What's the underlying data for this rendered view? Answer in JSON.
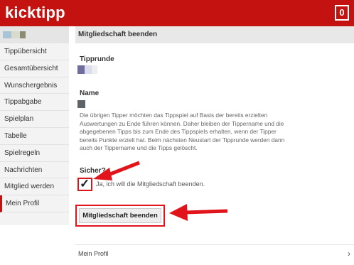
{
  "app": {
    "brand": "kicktipp",
    "badge_count": "0",
    "brand_color": "#c3120f"
  },
  "sidebar": {
    "items": [
      {
        "label": "Tippübersicht"
      },
      {
        "label": "Gesamtübersicht"
      },
      {
        "label": "Wunschergebnis"
      },
      {
        "label": "Tippabgabe"
      },
      {
        "label": "Spielplan"
      },
      {
        "label": "Tabelle"
      },
      {
        "label": "Spielregeln"
      },
      {
        "label": "Nachrichten"
      },
      {
        "label": "Mitglied werden"
      },
      {
        "label": "Mein Profil"
      }
    ],
    "active": "Mein Profil"
  },
  "main": {
    "title": "Mitgliedschaft beenden",
    "tipprunde_label": "Tipprunde",
    "name_label": "Name",
    "description": "Die übrigen Tipper möchten das Tippspiel auf Basis der bereits erzielten Auswertungen zu Ende führen können. Daher bleiben der Tippername und die abgegebenen Tipps bis zum Ende des Tippspiels erhalten, wenn der Tipper bereits Punkte erzielt hat. Beim nächsten Neustart der Tipprunde werden dann auch der Tippername und die Tipps gelöscht.",
    "sicher_label": "Sicher?",
    "checkbox_label": "Ja, ich will die Mitgliedschaft beenden.",
    "checkbox_checked": true,
    "submit_label": "Mitgliedschaft beenden"
  },
  "footer": {
    "link_label": "Mein Profil",
    "chevron": "›"
  },
  "annotations": {
    "arrow_color": "#e0141a",
    "highlight_color": "#e0141a"
  }
}
